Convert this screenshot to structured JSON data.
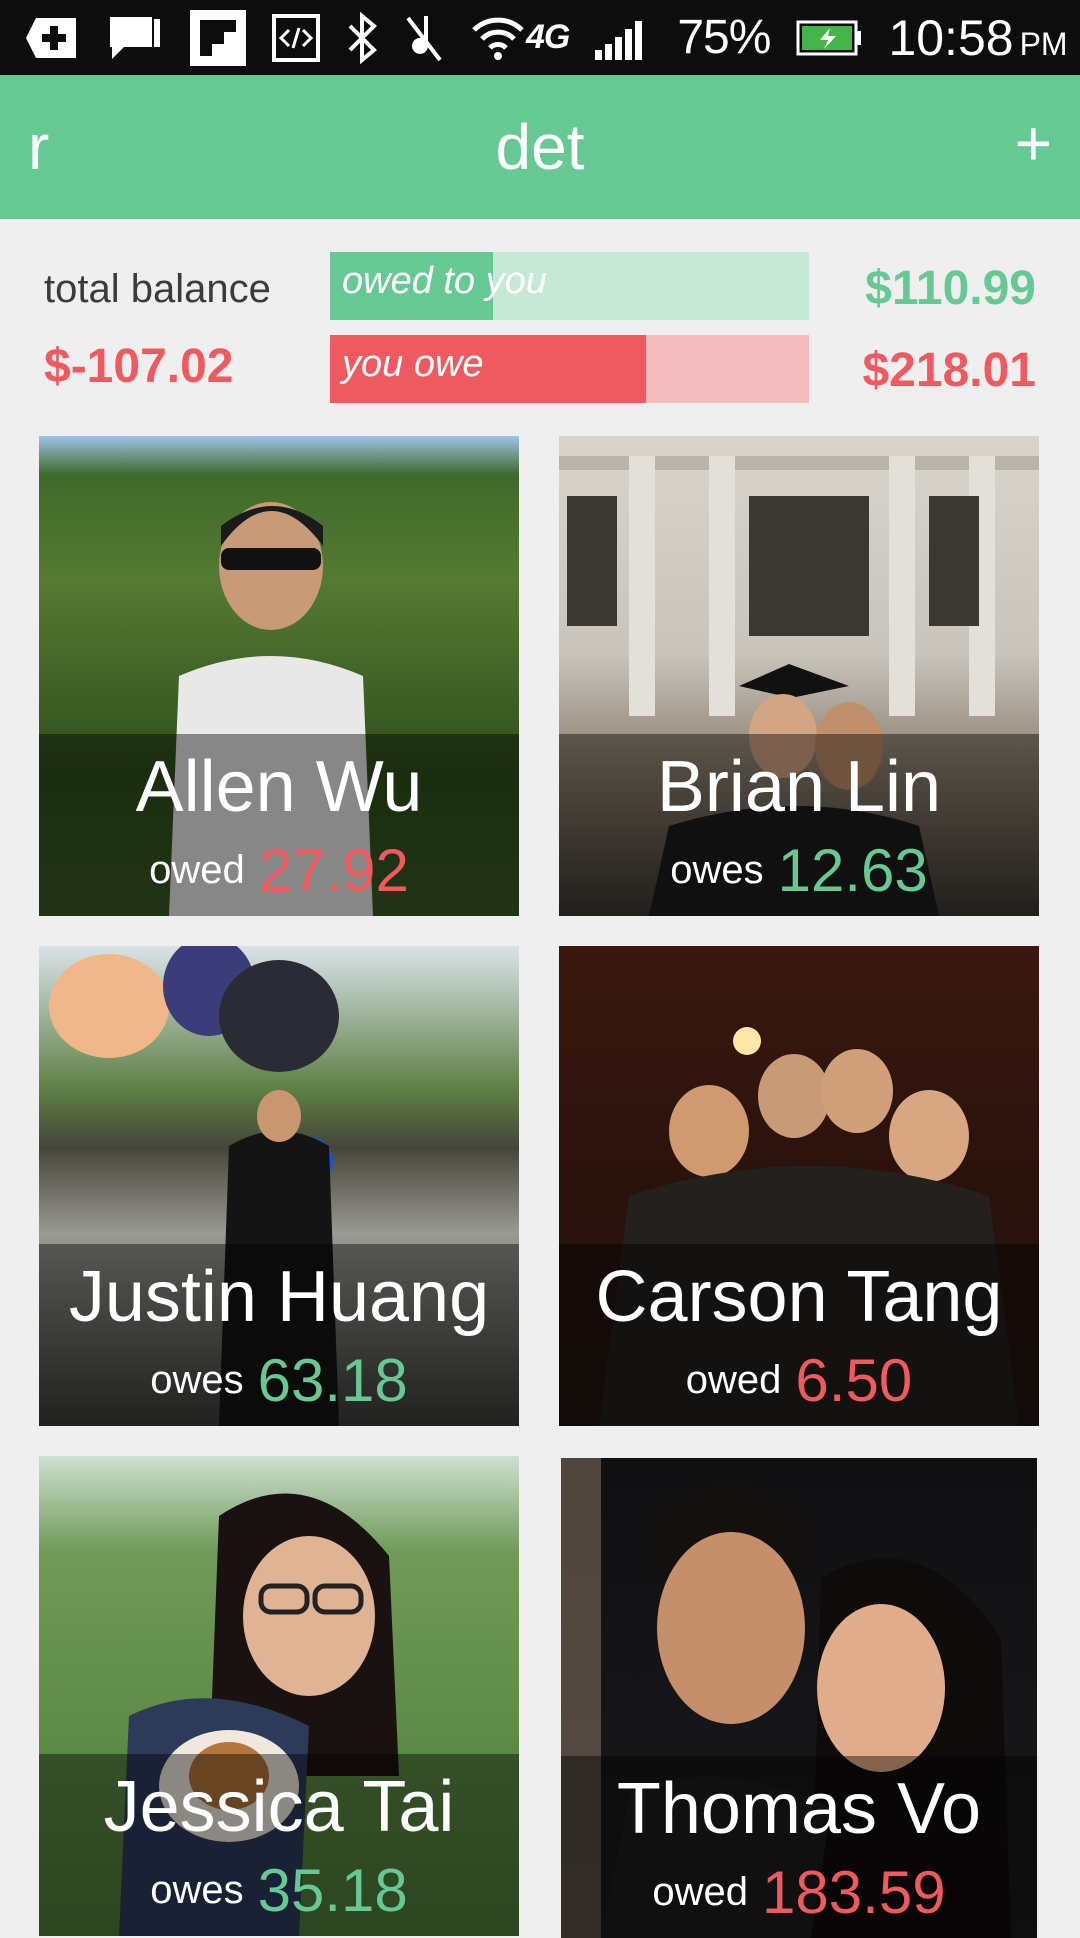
{
  "status_bar": {
    "battery_percent": "75%",
    "time": "10:58",
    "ampm": "PM",
    "network": "4G",
    "icons": [
      "add-icon",
      "message-icon",
      "flipboard-icon",
      "code-icon",
      "bluetooth-icon",
      "mute-icon",
      "wifi-icon",
      "4g-icon",
      "signal-icon",
      "battery-charging-icon"
    ]
  },
  "app_bar": {
    "left_label": "r",
    "title": "det",
    "add_label": "+"
  },
  "balance": {
    "label": "total balance",
    "total": "$-107.02",
    "owed_to_you_label": "owed to you",
    "owed_to_you_amount": "$110.99",
    "owed_to_you_fill_fraction": 0.34,
    "you_owe_label": "you owe",
    "you_owe_amount": "$218.01",
    "you_owe_fill_fraction": 0.66
  },
  "friends": [
    {
      "name": "Allen Wu",
      "verb": "owed",
      "amount": "27.92",
      "color": "red"
    },
    {
      "name": "Brian Lin",
      "verb": "owes",
      "amount": "12.63",
      "color": "green"
    },
    {
      "name": "Justin Huang",
      "verb": "owes",
      "amount": "63.18",
      "color": "green"
    },
    {
      "name": "Carson Tang",
      "verb": "owed",
      "amount": "6.50",
      "color": "red"
    },
    {
      "name": "Jessica Tai",
      "verb": "owes",
      "amount": "35.18",
      "color": "green"
    },
    {
      "name": "Thomas Vo",
      "verb": "owed",
      "amount": "183.59",
      "color": "red"
    }
  ],
  "colors": {
    "accent_green": "#66c993",
    "accent_red": "#ee5a5f",
    "light_green": "#c6e9d6",
    "light_red": "#f4bcbf"
  }
}
